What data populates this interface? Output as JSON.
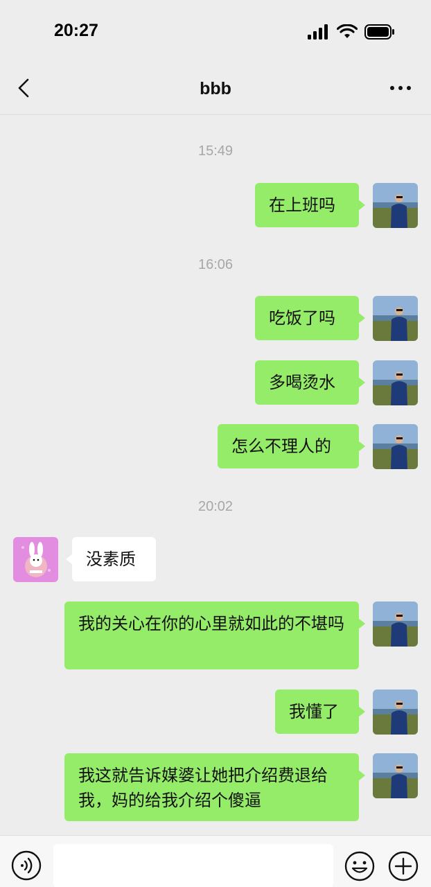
{
  "status_bar": {
    "time": "20:27"
  },
  "nav": {
    "title": "bbb"
  },
  "messages": [
    {
      "type": "timestamp",
      "text": "15:49"
    },
    {
      "type": "outgoing",
      "text": "在上班吗"
    },
    {
      "type": "timestamp",
      "text": "16:06"
    },
    {
      "type": "outgoing",
      "text": "吃饭了吗"
    },
    {
      "type": "outgoing",
      "text": "多喝烫水"
    },
    {
      "type": "outgoing",
      "text": "怎么不理人的"
    },
    {
      "type": "timestamp",
      "text": "20:02"
    },
    {
      "type": "incoming",
      "text": "没素质"
    },
    {
      "type": "outgoing",
      "text": "我的关心在你的心里就如此的不堪吗"
    },
    {
      "type": "outgoing",
      "text": "我懂了"
    },
    {
      "type": "outgoing",
      "text": "我这就告诉媒婆让她把介绍费退给我，妈的给我介绍个傻逼"
    }
  ],
  "input": {
    "placeholder": ""
  },
  "colors": {
    "background": "#ededed",
    "outgoing_bubble": "#95ec69",
    "incoming_bubble": "#ffffff",
    "timestamp_text": "#a7a7a7"
  },
  "icons": {
    "back": "chevron-left-icon",
    "more": "more-dots-icon",
    "voice": "voice-icon",
    "emoji": "emoji-icon",
    "plus": "plus-icon"
  }
}
